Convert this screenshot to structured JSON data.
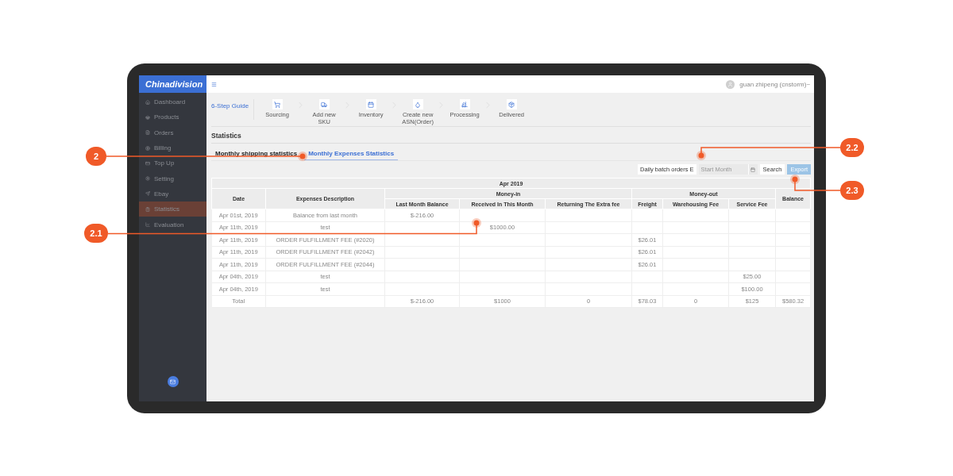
{
  "sidebar": {
    "logo": "Chinadivision",
    "items": [
      {
        "label": "Dashboard",
        "kind": "home",
        "selected": false
      },
      {
        "label": "Products",
        "kind": "basket",
        "selected": false
      },
      {
        "label": "Orders",
        "kind": "file",
        "selected": false
      },
      {
        "label": "Billing",
        "kind": "dollar",
        "selected": false
      },
      {
        "label": "Top Up",
        "kind": "card",
        "selected": false
      },
      {
        "label": "Setting",
        "kind": "gear",
        "selected": false
      },
      {
        "label": "Ebay",
        "kind": "send",
        "selected": false
      },
      {
        "label": "Statistics",
        "kind": "clipboard",
        "selected": true
      },
      {
        "label": "Evaluation",
        "kind": "chart",
        "selected": false
      }
    ]
  },
  "topbar": {
    "user": "guan zhipeng (cnstorm)~"
  },
  "guide": {
    "title": "6-Step Guide",
    "steps": [
      {
        "label": "Sourcing",
        "kind": "cart"
      },
      {
        "label": "Add new SKU",
        "kind": "truck"
      },
      {
        "label": "Inventory",
        "kind": "list"
      },
      {
        "label": "Create new ASN(Order)",
        "kind": "bottle"
      },
      {
        "label": "Processing",
        "kind": "forklift"
      },
      {
        "label": "Delivered",
        "kind": "box"
      }
    ]
  },
  "page_title": "Statistics",
  "tabs": [
    {
      "label": "Monthly shipping statistics",
      "selected": false
    },
    {
      "label": "Monthly Expenses Statistics",
      "selected": true
    }
  ],
  "toolbar": {
    "select": "Daily batch orders E",
    "start_month": {
      "placeholder": "Start Month"
    },
    "search": "Search",
    "export": "Export"
  },
  "table": {
    "period": "Apr 2019",
    "groups": {
      "money_in": "Money-in",
      "money_out": "Money-out"
    },
    "columns": [
      "Date",
      "Expenses Description",
      "Last Month Balance",
      "Received In This Month",
      "Returning The Extra fee",
      "Freight",
      "Warehousing Fee",
      "Service Fee",
      "Balance"
    ],
    "rows": [
      [
        "Apr 01st, 2019",
        "Balance from last month",
        "$-216.00",
        "",
        "",
        "",
        "",
        "",
        ""
      ],
      [
        "Apr 11th, 2019",
        "test",
        "",
        "$1000.00",
        "",
        "",
        "",
        "",
        ""
      ],
      [
        "Apr 11th, 2019",
        "ORDER FULFILLMENT FEE (#2020)",
        "",
        "",
        "",
        "$26.01",
        "",
        "",
        ""
      ],
      [
        "Apr 11th, 2019",
        "ORDER FULFILLMENT FEE (#2042)",
        "",
        "",
        "",
        "$26.01",
        "",
        "",
        ""
      ],
      [
        "Apr 11th, 2019",
        "ORDER FULFILLMENT FEE (#2044)",
        "",
        "",
        "",
        "$26.01",
        "",
        "",
        ""
      ],
      [
        "Apr 04th, 2019",
        "test",
        "",
        "",
        "",
        "",
        "",
        "$25.00",
        ""
      ],
      [
        "Apr 04th, 2019",
        "test",
        "",
        "",
        "",
        "",
        "",
        "$100.00",
        ""
      ],
      [
        "Total",
        "",
        "$-216.00",
        "$1000",
        "0",
        "$78.03",
        "0",
        "$125",
        "$580.32"
      ]
    ]
  },
  "callouts": [
    {
      "label": "2"
    },
    {
      "label": "2.1"
    },
    {
      "label": "2.2"
    },
    {
      "label": "2.3"
    }
  ]
}
